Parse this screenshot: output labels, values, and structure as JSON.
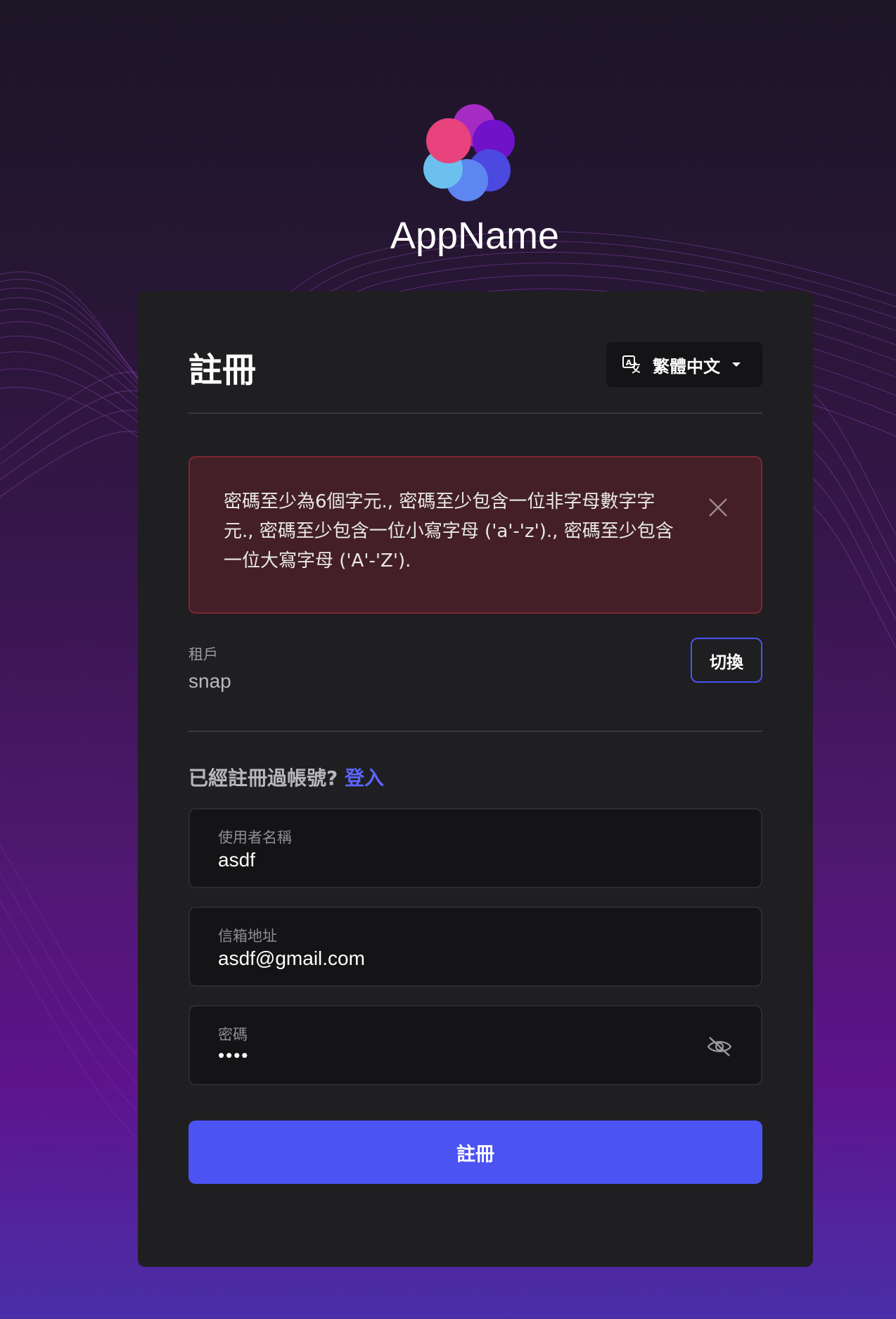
{
  "app": {
    "name": "AppName"
  },
  "card": {
    "title": "註冊",
    "language": {
      "label": "繁體中文",
      "icon": "translate-icon"
    }
  },
  "alert": {
    "message": "密碼至少為6個字元., 密碼至少包含一位非字母數字字元., 密碼至少包含一位小寫字母 ('a'-'z')., 密碼至少包含一位大寫字母 ('A'-'Z').",
    "close_icon": "close-icon"
  },
  "tenant": {
    "label": "租戶",
    "value": "snap",
    "switch_label": "切換"
  },
  "signin": {
    "prompt": "已經註冊過帳號?",
    "link": "登入"
  },
  "form": {
    "username": {
      "label": "使用者名稱",
      "value": "asdf"
    },
    "email": {
      "label": "信箱地址",
      "value": "asdf@gmail.com"
    },
    "password": {
      "label": "密碼",
      "value": "••••",
      "toggle_icon": "eye-off-icon"
    },
    "submit_label": "註冊"
  },
  "colors": {
    "accent": "#4b53f2",
    "link": "#5c66ff",
    "card_bg": "#1f1f21",
    "alert_bg": "#441f28",
    "alert_border": "#7a2634"
  }
}
